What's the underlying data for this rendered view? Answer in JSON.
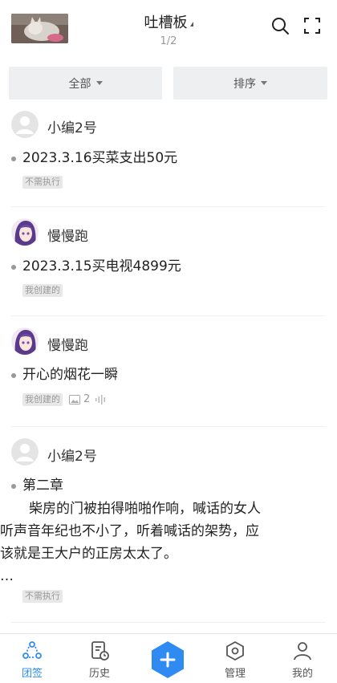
{
  "header": {
    "title": "吐槽板",
    "pager": "1/2",
    "thumbnail_icon": "cat-photo-thumbnail",
    "search_icon": "search-icon",
    "expand_icon": "fullscreen-icon"
  },
  "filters": {
    "all_label": "全部",
    "sort_label": "排序"
  },
  "posts": [
    {
      "author": "小编2号",
      "avatar_icon": "default-user-avatar",
      "text": "2023.3.16买菜支出50元",
      "tag": "不需执行"
    },
    {
      "author": "慢慢跑",
      "avatar_icon": "anime-girl-avatar",
      "text": "2023.3.15买电视4899元",
      "tag": "我创建的"
    },
    {
      "author": "慢慢跑",
      "avatar_icon": "anime-girl-avatar",
      "text": "开心的烟花一瞬",
      "tag": "我创建的",
      "image_count": "2"
    },
    {
      "author": "小编2号",
      "avatar_icon": "default-user-avatar",
      "title": "第二章",
      "body_line1": "柴房的门被拍得啪啪作响，喊话的女人",
      "body_line2": "听声音年纪也不小了，听着喊话的架势，应",
      "body_line3": "该就是王大户的正房太太了。",
      "ellipsis": "…",
      "tag": "不需执行"
    }
  ],
  "bottom_nav": {
    "items": [
      {
        "label": "团签",
        "icon": "team-sign-icon"
      },
      {
        "label": "历史",
        "icon": "history-icon"
      },
      {
        "label": "",
        "icon": "add-icon"
      },
      {
        "label": "管理",
        "icon": "manage-hexagon-icon"
      },
      {
        "label": "我的",
        "icon": "profile-icon"
      }
    ]
  },
  "colors": {
    "accent": "#2f8bf2",
    "tag_bg": "#e8e8e8",
    "filter_bg": "#eeeff1"
  }
}
